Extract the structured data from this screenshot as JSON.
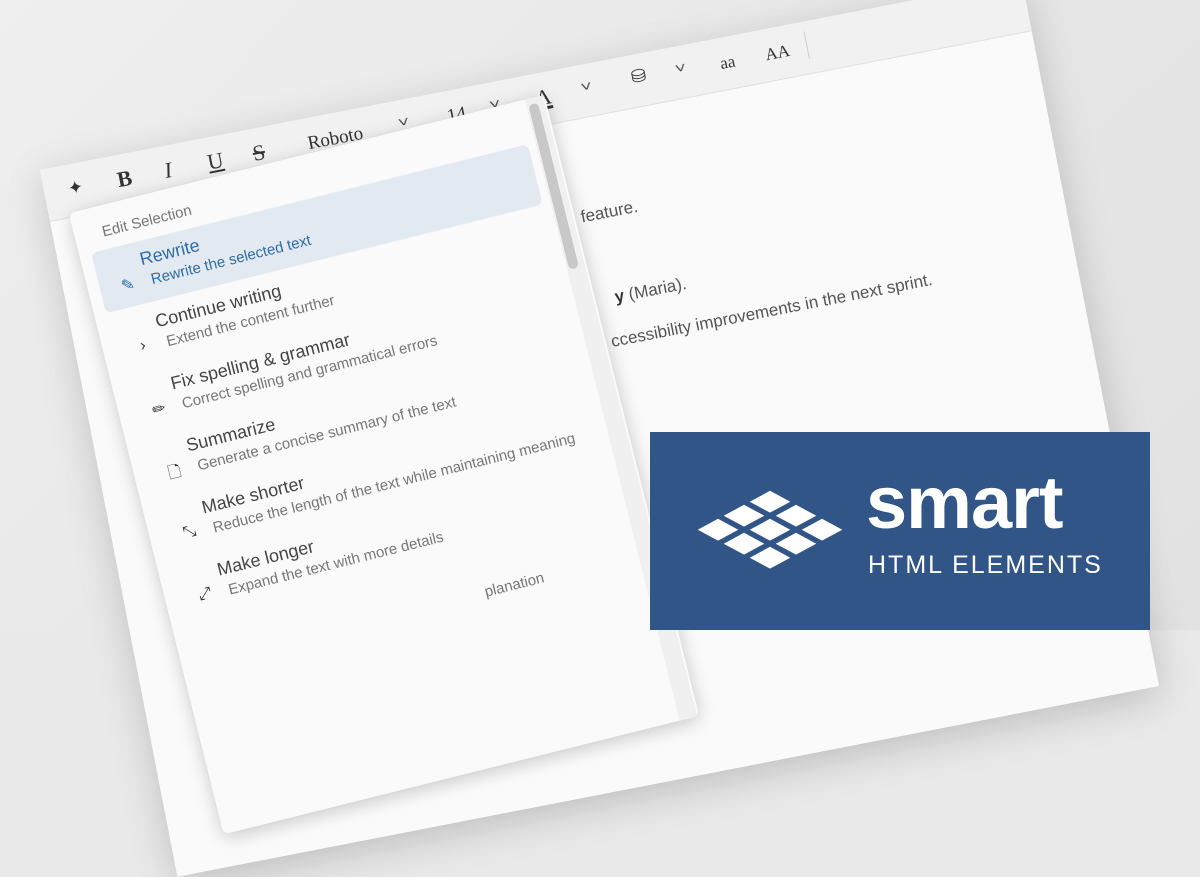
{
  "toolbar": {
    "ai_icon": "sparkle-icon",
    "bold": "B",
    "italic": "I",
    "underline": "U",
    "strikethrough": "S",
    "font_family": "Roboto",
    "font_size": "14",
    "font_color": "A",
    "lowercase": "aa",
    "uppercase": "AA"
  },
  "content": {
    "line1": "feature.",
    "line2_bold": "y",
    "line2": " (Maria).",
    "line3": "ccessibility improvements in the next sprint."
  },
  "menu": {
    "header": "Edit Selection",
    "items": [
      {
        "label": "Rewrite",
        "desc": "Rewrite the selected text",
        "icon": "edit-icon",
        "active": true
      },
      {
        "label": "Continue writing",
        "desc": "Extend the content further",
        "icon": "chevron-right-icon"
      },
      {
        "label": "Fix spelling & grammar",
        "desc": "Correct spelling and grammatical errors",
        "icon": "pencil-icon"
      },
      {
        "label": "Summarize",
        "desc": "Generate a concise summary of the text",
        "icon": "document-icon"
      },
      {
        "label": "Make shorter",
        "desc": "Reduce the length of the text while maintaining meaning",
        "icon": "compress-icon"
      },
      {
        "label": "Make longer",
        "desc": "Expand the text with more details",
        "icon": "expand-icon"
      }
    ],
    "partial_desc": "planation"
  },
  "brand": {
    "name": "smart",
    "tagline": "HTML ELEMENTS",
    "color": "#325587"
  }
}
